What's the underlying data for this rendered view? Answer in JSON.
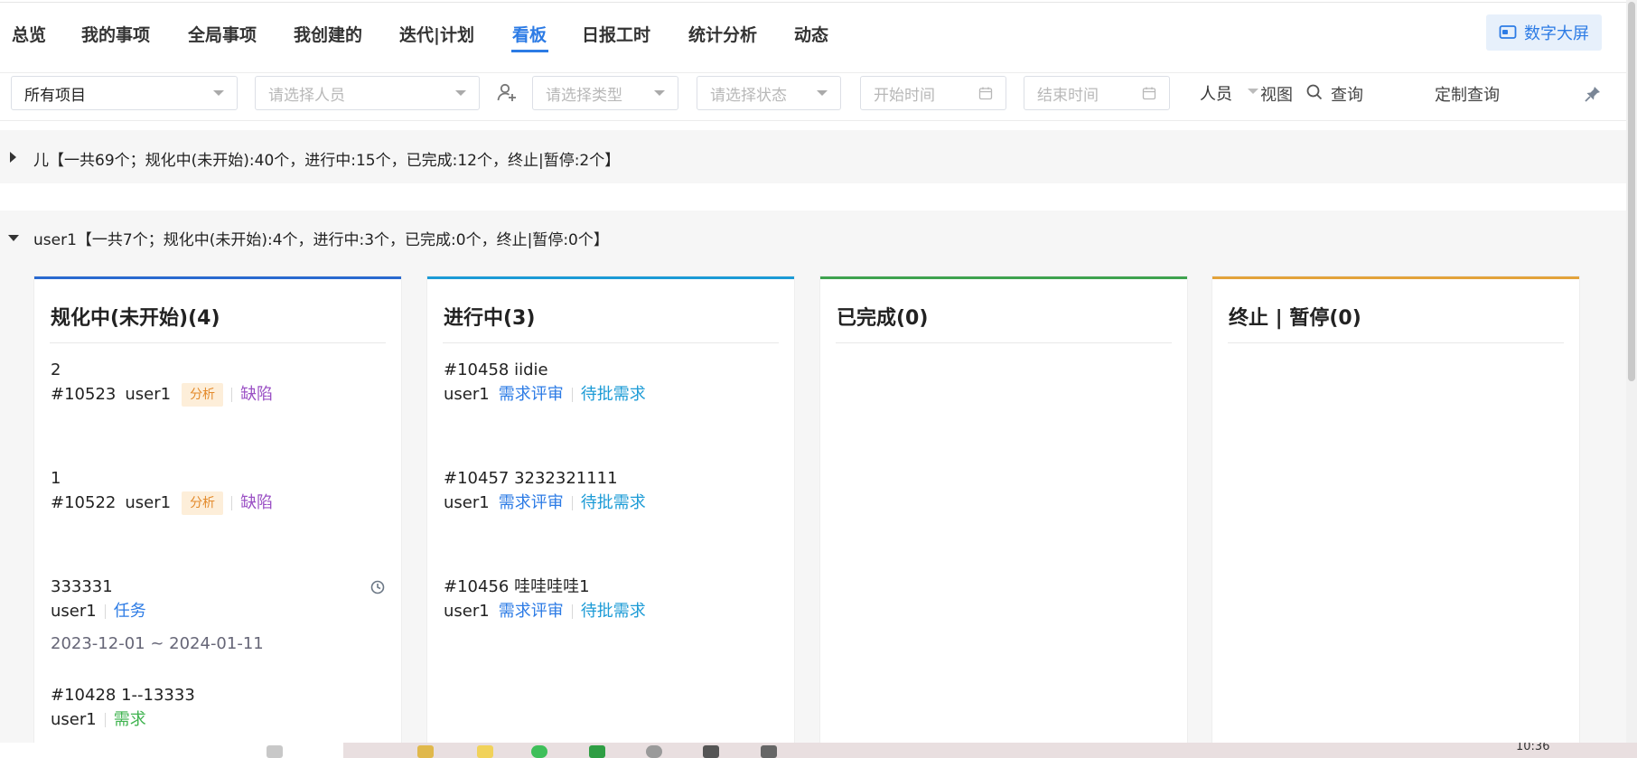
{
  "nav": {
    "items": [
      {
        "label": "总览"
      },
      {
        "label": "我的事项"
      },
      {
        "label": "全局事项"
      },
      {
        "label": "我创建的"
      },
      {
        "label": "迭代|计划"
      },
      {
        "label": "看板",
        "active": true
      },
      {
        "label": "日报工时"
      },
      {
        "label": "统计分析"
      },
      {
        "label": "动态"
      }
    ],
    "screen_button": "数字大屏"
  },
  "filters": {
    "project": "所有项目",
    "person_placeholder": "请选择人员",
    "type_placeholder": "请选择类型",
    "status_placeholder": "请选择状态",
    "start_placeholder": "开始时间",
    "end_placeholder": "结束时间",
    "people_label": "人员",
    "view_label": "视图",
    "query_label": "查询",
    "custom_query_label": "定制查询"
  },
  "groups": [
    {
      "title": "儿【一共69个；规化中(未开始):40个，进行中:15个，已完成:12个，终止|暂停:2个】",
      "expanded": false
    },
    {
      "title": "user1【一共7个；规化中(未开始):4个，进行中:3个，已完成:0个，终止|暂停:0个】",
      "expanded": true
    }
  ],
  "columns": [
    {
      "title": "规化中(未开始)(4)",
      "color": "#2a6ad0",
      "cards": [
        {
          "title": "2",
          "id": "#10523",
          "user": "user1",
          "tag": "分析",
          "type": "缺陷"
        },
        {
          "title": "1",
          "id": "#10522",
          "user": "user1",
          "tag": "分析",
          "type": "缺陷"
        },
        {
          "title": "333331",
          "user": "user1",
          "type": "任务",
          "dates": "2023-12-01 ~ 2024-01-11"
        },
        {
          "title": "#10428 1--13333",
          "user": "user1",
          "type": "需求"
        }
      ]
    },
    {
      "title": "进行中(3)",
      "color": "#1c9bd6",
      "cards": [
        {
          "title": "#10458 iidie",
          "user": "user1",
          "stage": "需求评审",
          "type": "待批需求"
        },
        {
          "title": "#10457 3232321111",
          "user": "user1",
          "stage": "需求评审",
          "type": "待批需求"
        },
        {
          "title": "#10456 哇哇哇哇1",
          "user": "user1",
          "stage": "需求评审",
          "type": "待批需求"
        }
      ]
    },
    {
      "title": "已完成(0)",
      "color": "#3fa34f",
      "cards": []
    },
    {
      "title": "终止 | 暂停(0)",
      "color": "#e3a33b",
      "cards": []
    }
  ],
  "taskbar": {
    "time": "10:36"
  }
}
